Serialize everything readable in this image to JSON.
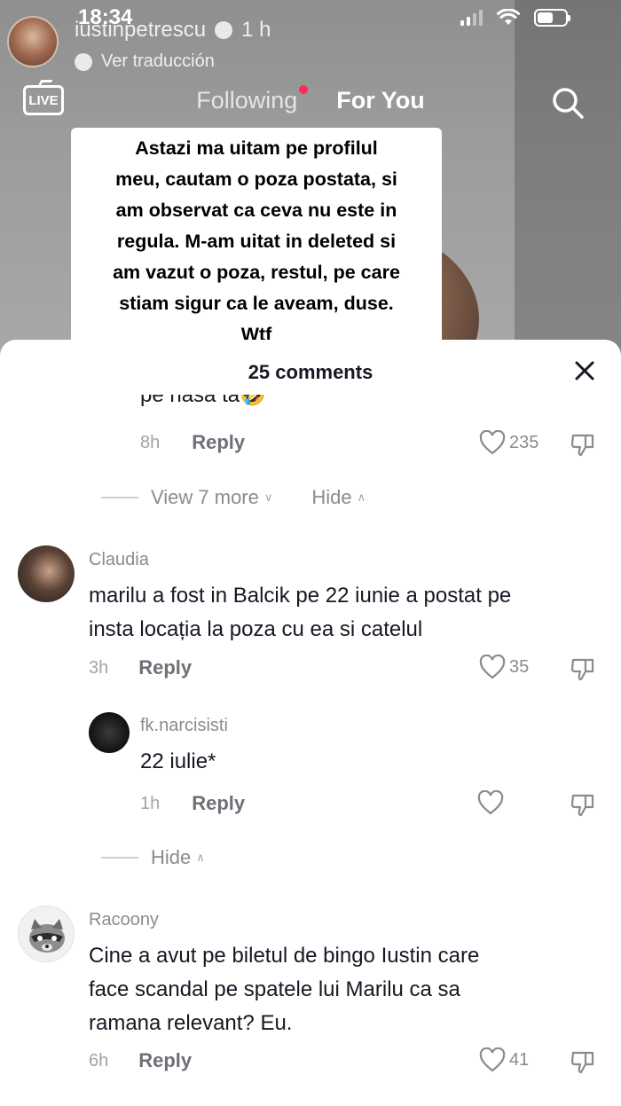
{
  "status_bar": {
    "time": "18:34"
  },
  "creator": {
    "username": "iustinpetrescu",
    "age": "1 h",
    "translate_label": "Ver traducción"
  },
  "live": {
    "label": "LIVE"
  },
  "tabs": {
    "following": "Following",
    "for_you": "For You"
  },
  "caption_lines": [
    "Astazi ma uitam pe profilul",
    "meu, cautam o poza postata, si",
    "am observat ca ceva nu este in",
    "regula. M-am uitat in deleted si",
    "am vazut o poza, restul, pe care",
    "stiam sigur ca le aveam, duse.",
    "Wtf"
  ],
  "comments_sheet": {
    "title": "25 comments",
    "truncated_comment": {
      "partial_text": "pe nasa ta🤣",
      "time": "8h",
      "reply_label": "Reply",
      "likes": "235"
    },
    "view_more_label": "View 7 more",
    "hide_label": "Hide",
    "comments": [
      {
        "user": "Claudia",
        "text_lines": [
          "marilu a fost in Balcik pe 22 iunie a postat pe",
          "insta locația la poza cu ea si catelul"
        ],
        "time": "3h",
        "reply_label": "Reply",
        "likes": "35",
        "replies": [
          {
            "user": "fk.narcisisti",
            "text": "22 iulie*",
            "time": "1h",
            "reply_label": "Reply",
            "likes": ""
          }
        ],
        "hide_label": "Hide"
      },
      {
        "user": "Racoony",
        "text_lines": [
          "Cine a avut pe biletul de bingo Iustin care",
          "face scandal pe spatele lui Marilu ca sa",
          "ramana relevant? Eu."
        ],
        "time": "6h",
        "reply_label": "Reply",
        "likes": "41"
      }
    ]
  },
  "colors": {
    "accent": "#fe2c55",
    "text": "#161823",
    "muted": "#8a8b91"
  }
}
